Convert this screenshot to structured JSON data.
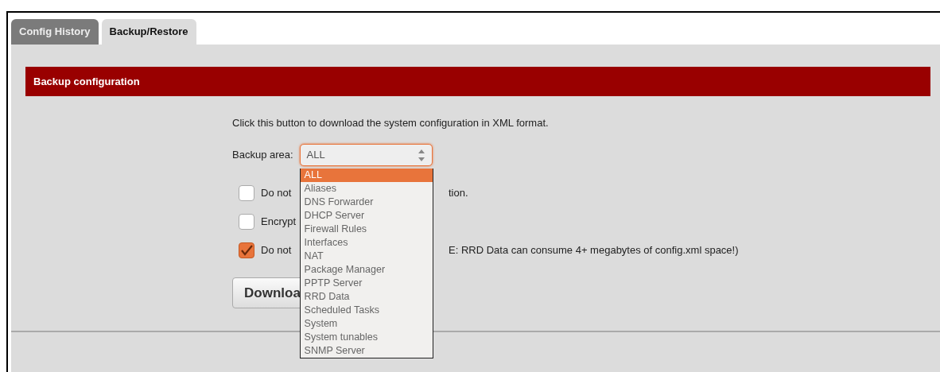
{
  "tabs": [
    {
      "label": "Config History",
      "selected": false
    },
    {
      "label": "Backup/Restore",
      "selected": true
    }
  ],
  "section": {
    "title": "Backup configuration",
    "intro": "Click this button to download the system configuration in XML format.",
    "backup_area": {
      "label": "Backup area:",
      "value": "ALL",
      "expanded": true,
      "options": [
        {
          "label": "ALL",
          "selected": true
        },
        {
          "label": "Aliases",
          "selected": false
        },
        {
          "label": "DNS Forwarder",
          "selected": false
        },
        {
          "label": "DHCP Server",
          "selected": false
        },
        {
          "label": "Firewall Rules",
          "selected": false
        },
        {
          "label": "Interfaces",
          "selected": false
        },
        {
          "label": "NAT",
          "selected": false
        },
        {
          "label": "Package Manager",
          "selected": false
        },
        {
          "label": "PPTP Server",
          "selected": false
        },
        {
          "label": "RRD Data",
          "selected": false
        },
        {
          "label": "Scheduled Tasks",
          "selected": false
        },
        {
          "label": "System",
          "selected": false
        },
        {
          "label": "System tunables",
          "selected": false
        },
        {
          "label": "SNMP Server",
          "selected": false
        }
      ]
    },
    "options": [
      {
        "text_left": "Do not",
        "text_right": "tion.",
        "checked": false
      },
      {
        "text_left": "Encrypt",
        "checked": false
      },
      {
        "text_left": "Do not",
        "text_right": "E: RRD Data can consume 4+ megabytes of config.xml space!)",
        "checked": true
      }
    ],
    "download_button": "Downloa"
  }
}
